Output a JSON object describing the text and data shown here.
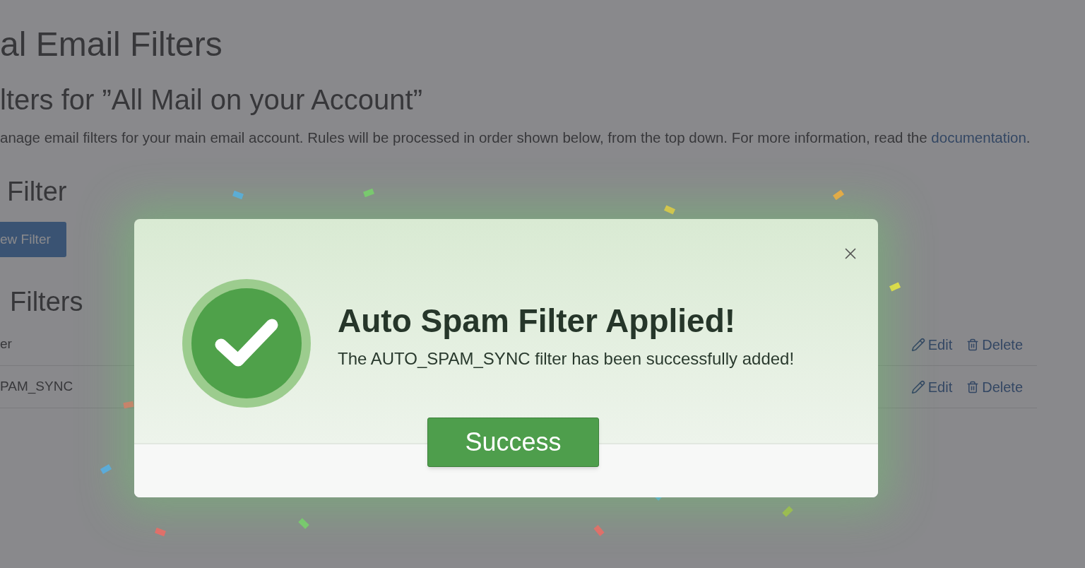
{
  "page": {
    "title": "al Email Filters",
    "subtitle": "lters for ”All Mail on your Account”",
    "description": "anage email filters for your main email account. Rules will be processed in order shown below, from the top down. For more information, read the ",
    "link": "documentation",
    "link_end": "."
  },
  "create_section": {
    "heading": "Filter",
    "button": "ew Filter"
  },
  "list_section": {
    "heading": "Filters",
    "rows": [
      {
        "name": "er",
        "actions": [
          {
            "label": "Edit",
            "kind": "edit"
          },
          {
            "label": "Delete",
            "kind": "delete"
          }
        ]
      },
      {
        "name": "PAM_SYNC",
        "actions": [
          {
            "label": "Edit",
            "kind": "edit"
          },
          {
            "label": "Delete",
            "kind": "delete"
          }
        ]
      }
    ]
  },
  "dialog": {
    "title": "Auto Spam Filter Applied!",
    "message": "The AUTO_SPAM_SYNC filter has been successfully added!",
    "button": "Success"
  }
}
